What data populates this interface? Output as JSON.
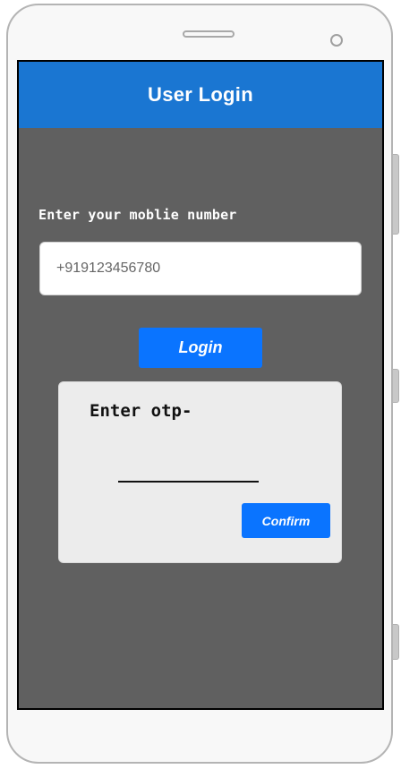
{
  "header": {
    "title": "User Login"
  },
  "login_form": {
    "mobile_label": "Enter your moblie number",
    "mobile_input": {
      "value": "",
      "placeholder": "+919123456780"
    },
    "login_label": "Login"
  },
  "otp_card": {
    "label": "Enter otp-",
    "otp_input": {
      "value": "",
      "placeholder": ""
    },
    "confirm_label": "Confirm"
  },
  "colors": {
    "header_bg": "#1a76d2",
    "screen_bg": "#606060",
    "button_bg": "#0a74ff",
    "card_bg": "#ececec"
  },
  "icons": {
    "speaker": "speaker-grille-icon",
    "camera": "front-camera-icon"
  }
}
